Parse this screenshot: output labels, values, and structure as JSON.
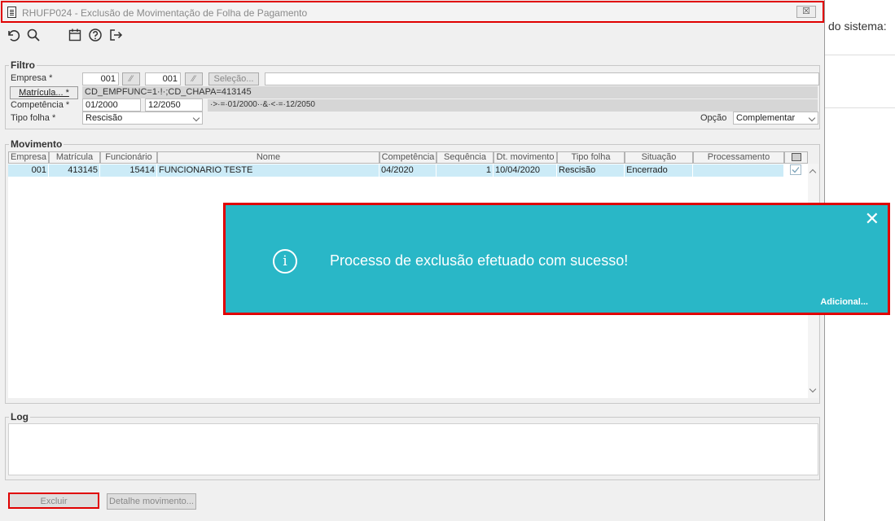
{
  "background": {
    "system_text": "do sistema: "
  },
  "window": {
    "title": "RHUFP024 - Exclusão de Movimentação de Folha de Pagamento",
    "close_label": "☒"
  },
  "toolbar": {
    "icons": [
      "undo-icon",
      "search-icon",
      "calendar-icon",
      "help-icon",
      "exit-icon"
    ]
  },
  "filter": {
    "legend": "Filtro",
    "empresa_label": "Empresa *",
    "empresa_from": "001",
    "empresa_to": "001",
    "selecao_label": "Seleção...",
    "selecao_value": "",
    "matricula_label": "Matrícula... *",
    "matricula_expr": "CD_EMPFUNC=1·!·;CD_CHAPA=413145",
    "competencia_label": "Competência *",
    "competencia_from": "01/2000",
    "competencia_to": "12/2050",
    "competencia_expr": "·>·=·01/2000··&·<·=·12/2050",
    "tipo_folha_label": "Tipo folha *",
    "tipo_folha_value": "Rescisão",
    "opcao_label": "Opção",
    "opcao_value": "Complementar"
  },
  "movimento": {
    "legend": "Movimento",
    "columns": [
      "Empresa",
      "Matrícula",
      "Funcionário",
      "Nome",
      "Competência",
      "Sequência",
      "Dt. movimento",
      "Tipo folha",
      "Situação",
      "Processamento"
    ],
    "rows": [
      {
        "empresa": "001",
        "matricula": "413145",
        "funcionario": "15414",
        "nome": "FUNCIONARIO TESTE",
        "competencia": "04/2020",
        "sequencia": "1",
        "dt_movimento": "10/04/2020",
        "tipo_folha": "Rescisão",
        "situacao": "Encerrado",
        "processamento": "",
        "checked": true
      }
    ]
  },
  "toast": {
    "message": "Processo de exclusão efetuado com sucesso!",
    "additional": "Adicional...",
    "close": "✕",
    "info": "i"
  },
  "log": {
    "legend": "Log",
    "value": ""
  },
  "actions": {
    "excluir": "Excluir",
    "detalhe": "Detalhe movimento..."
  },
  "colors": {
    "toast": "#29b7c7",
    "highlight": "#e00000",
    "selected_row": "#ccebf7"
  }
}
